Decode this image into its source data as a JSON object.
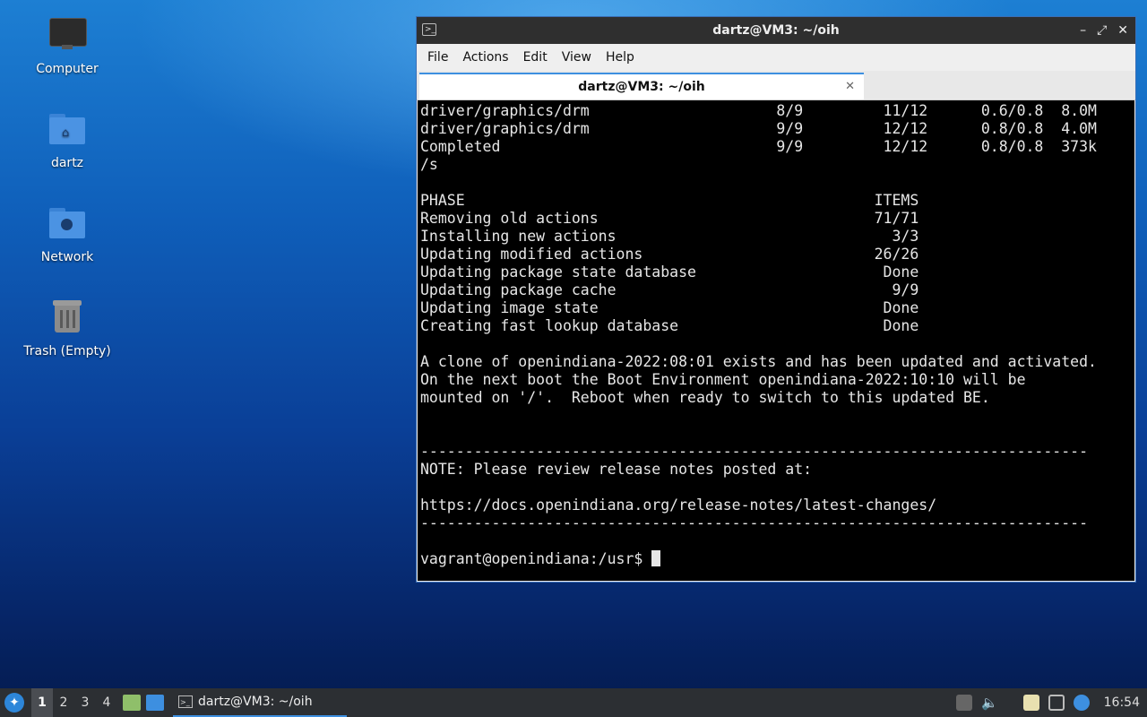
{
  "desktop": {
    "icons": [
      {
        "label": "Computer"
      },
      {
        "label": "dartz"
      },
      {
        "label": "Network"
      },
      {
        "label": "Trash (Empty)"
      }
    ]
  },
  "window": {
    "title": "dartz@VM3: ~/oih",
    "controls": {
      "minimize": "–",
      "maximize": "⤢",
      "close": "✕"
    },
    "menu": [
      "File",
      "Actions",
      "Edit",
      "View",
      "Help"
    ],
    "tab": {
      "label": "dartz@VM3: ~/oih",
      "close": "✕"
    }
  },
  "terminal": {
    "lines": [
      "driver/graphics/drm                     8/9         11/12      0.6/0.8  8.0M",
      "driver/graphics/drm                     9/9         12/12      0.8/0.8  4.0M",
      "Completed                               9/9         12/12      0.8/0.8  373k",
      "/s",
      "",
      "PHASE                                              ITEMS",
      "Removing old actions                               71/71",
      "Installing new actions                               3/3",
      "Updating modified actions                          26/26",
      "Updating package state database                     Done",
      "Updating package cache                               9/9",
      "Updating image state                                Done",
      "Creating fast lookup database                       Done",
      "",
      "A clone of openindiana-2022:08:01 exists and has been updated and activated.",
      "On the next boot the Boot Environment openindiana-2022:10:10 will be",
      "mounted on '/'.  Reboot when ready to switch to this updated BE.",
      "",
      "",
      "---------------------------------------------------------------------------",
      "NOTE: Please review release notes posted at:",
      "",
      "https://docs.openindiana.org/release-notes/latest-changes/",
      "---------------------------------------------------------------------------",
      "",
      "vagrant@openindiana:/usr$ "
    ]
  },
  "taskbar": {
    "workspaces": [
      "1",
      "2",
      "3",
      "4"
    ],
    "active_workspace": "1",
    "task_label": "dartz@VM3: ~/oih",
    "clock": "16:54"
  }
}
